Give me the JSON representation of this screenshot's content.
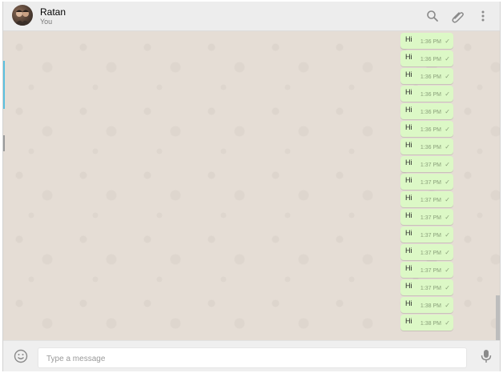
{
  "header": {
    "name": "Ratan",
    "subtitle": "You",
    "icons": [
      "search-icon",
      "attach-icon",
      "menu-icon"
    ]
  },
  "messages": [
    {
      "text": "Hi",
      "time": "1:36 PM",
      "status": "✓"
    },
    {
      "text": "Hi",
      "time": "1:36 PM",
      "status": "✓"
    },
    {
      "text": "Hi",
      "time": "1:36 PM",
      "status": "✓"
    },
    {
      "text": "Hi",
      "time": "1:36 PM",
      "status": "✓"
    },
    {
      "text": "Hi",
      "time": "1:36 PM",
      "status": "✓"
    },
    {
      "text": "Hi",
      "time": "1:36 PM",
      "status": "✓"
    },
    {
      "text": "Hi",
      "time": "1:36 PM",
      "status": "✓"
    },
    {
      "text": "Hi",
      "time": "1:37 PM",
      "status": "✓"
    },
    {
      "text": "Hi",
      "time": "1:37 PM",
      "status": "✓"
    },
    {
      "text": "Hi",
      "time": "1:37 PM",
      "status": "✓"
    },
    {
      "text": "Hi",
      "time": "1:37 PM",
      "status": "✓"
    },
    {
      "text": "Hi",
      "time": "1:37 PM",
      "status": "✓"
    },
    {
      "text": "Hi",
      "time": "1:37 PM",
      "status": "✓"
    },
    {
      "text": "Hi",
      "time": "1:37 PM",
      "status": "✓"
    },
    {
      "text": "Hi",
      "time": "1:37 PM",
      "status": "✓"
    },
    {
      "text": "Hi",
      "time": "1:38 PM",
      "status": "✓"
    },
    {
      "text": "Hi",
      "time": "1:38 PM",
      "status": "✓"
    }
  ],
  "footer": {
    "placeholder": "Type a message",
    "icons": [
      "emoji-icon",
      "mic-icon"
    ]
  },
  "colors": {
    "chat_bg": "#e5ddd5",
    "bubble_out": "#dcf8c6",
    "header_bg": "#ededed",
    "footer_bg": "#efefef"
  }
}
